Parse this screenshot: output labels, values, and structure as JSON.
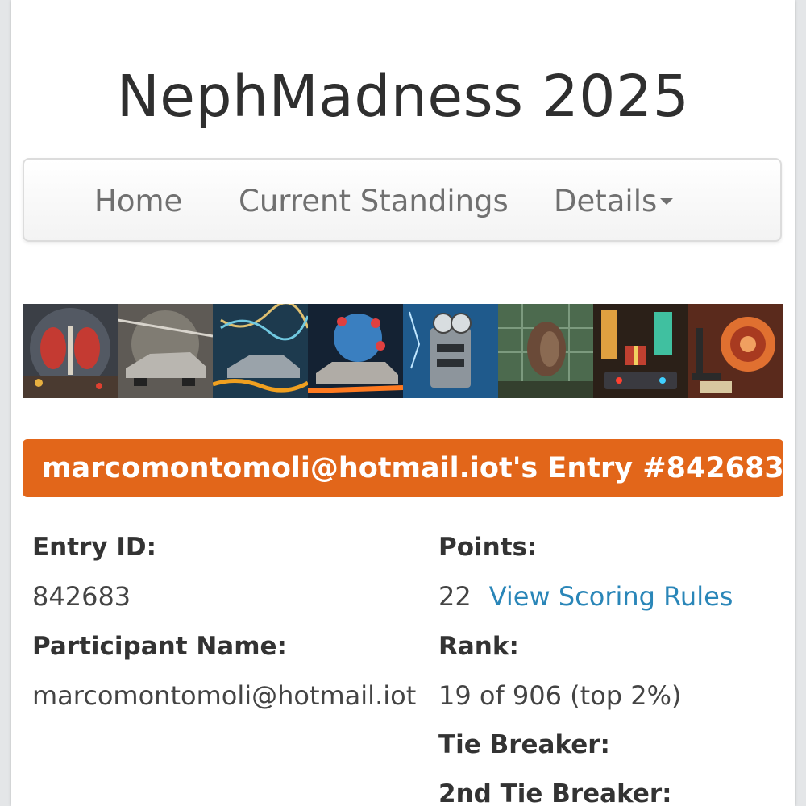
{
  "site": {
    "title": "NephMadness 2025"
  },
  "nav": {
    "home": "Home",
    "standings": "Current Standings",
    "details": "Details"
  },
  "banner": {
    "images": [
      "kidney-pair-image",
      "delorean-storm-image",
      "delorean-dna-image",
      "virus-car-image",
      "lab-machine-image",
      "greenhouse-kidney-image",
      "neon-gift-image",
      "kidney-microscope-image"
    ]
  },
  "entry": {
    "header": "marcomontomoli@hotmail.iot's Entry #842683",
    "entry_id_label": "Entry ID:",
    "entry_id": "842683",
    "participant_label": "Participant Name:",
    "participant": "marcomontomoli@hotmail.iot",
    "points_label": "Points:",
    "points": "22",
    "scoring_link": "View Scoring Rules",
    "rank_label": "Rank:",
    "rank": "19 of 906 (top 2%)",
    "tiebreaker_label": "Tie Breaker:",
    "tiebreaker2_label": "2nd Tie Breaker:"
  },
  "colors": {
    "accent": "#e2661a",
    "link": "#2a86b8"
  }
}
